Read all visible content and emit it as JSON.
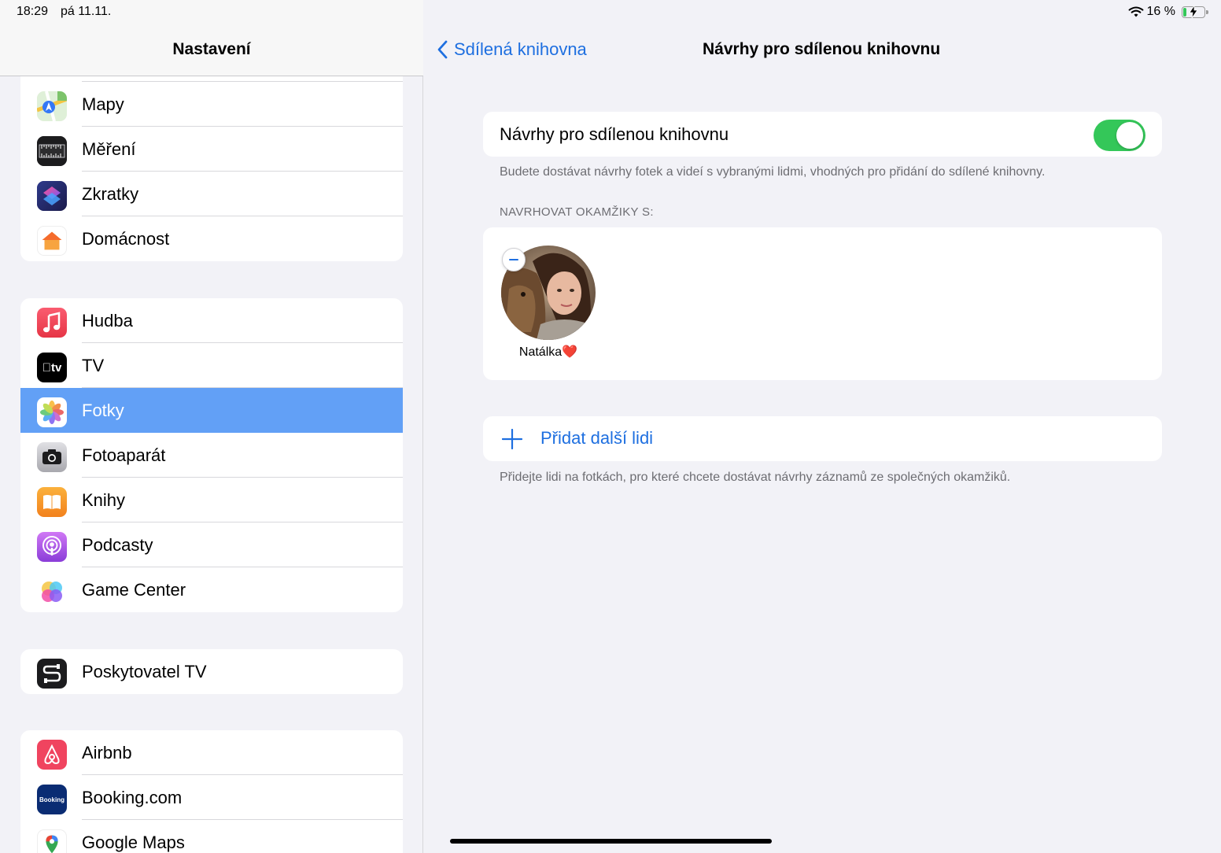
{
  "status_bar": {
    "time": "18:29",
    "date": "pá 11.11.",
    "battery_text": "16 %",
    "battery_level": 0.16
  },
  "sidebar": {
    "title": "Nastavení",
    "groups": [
      {
        "items": [
          {
            "label": "Mapy",
            "icon": "maps-icon"
          },
          {
            "label": "Měření",
            "icon": "measure-icon"
          },
          {
            "label": "Zkratky",
            "icon": "shortcuts-icon"
          },
          {
            "label": "Domácnost",
            "icon": "home-icon"
          }
        ]
      },
      {
        "items": [
          {
            "label": "Hudba",
            "icon": "music-icon"
          },
          {
            "label": "TV",
            "icon": "tv-icon",
            "glyph": "tv"
          },
          {
            "label": "Fotky",
            "icon": "photos-icon",
            "selected": true
          },
          {
            "label": "Fotoaparát",
            "icon": "camera-icon"
          },
          {
            "label": "Knihy",
            "icon": "books-icon"
          },
          {
            "label": "Podcasty",
            "icon": "podcasts-icon"
          },
          {
            "label": "Game Center",
            "icon": "game-center-icon"
          }
        ]
      },
      {
        "items": [
          {
            "label": "Poskytovatel TV",
            "icon": "tv-provider-icon"
          }
        ]
      },
      {
        "items": [
          {
            "label": "Airbnb",
            "icon": "airbnb-icon"
          },
          {
            "label": "Booking.com",
            "icon": "booking-icon",
            "glyph": "Booking"
          },
          {
            "label": "Google Maps",
            "icon": "google-maps-icon"
          }
        ]
      }
    ]
  },
  "detail": {
    "back_label": "Sdílená knihovna",
    "title": "Návrhy pro sdílenou knihovnu",
    "toggle": {
      "label": "Návrhy pro sdílenou knihovnu",
      "on": true
    },
    "toggle_footnote": "Budete dostávat návrhy fotek a videí s vybranými lidmi, vhodných pro přidání do sdílené knihovny.",
    "section_header": "NAVRHOVAT OKAMŽIKY S:",
    "people": [
      {
        "name": "Natálka❤️"
      }
    ],
    "add_label": "Přidat další lidi",
    "add_footnote": "Přidejte lidi na fotkách, pro které chcete dostávat návrhy záznamů ze společných okamžiků."
  },
  "colors": {
    "accent": "#1e6fe0",
    "selected_row": "#62a0f6",
    "toggle_on": "#34c759",
    "background": "#f2f2f7"
  }
}
